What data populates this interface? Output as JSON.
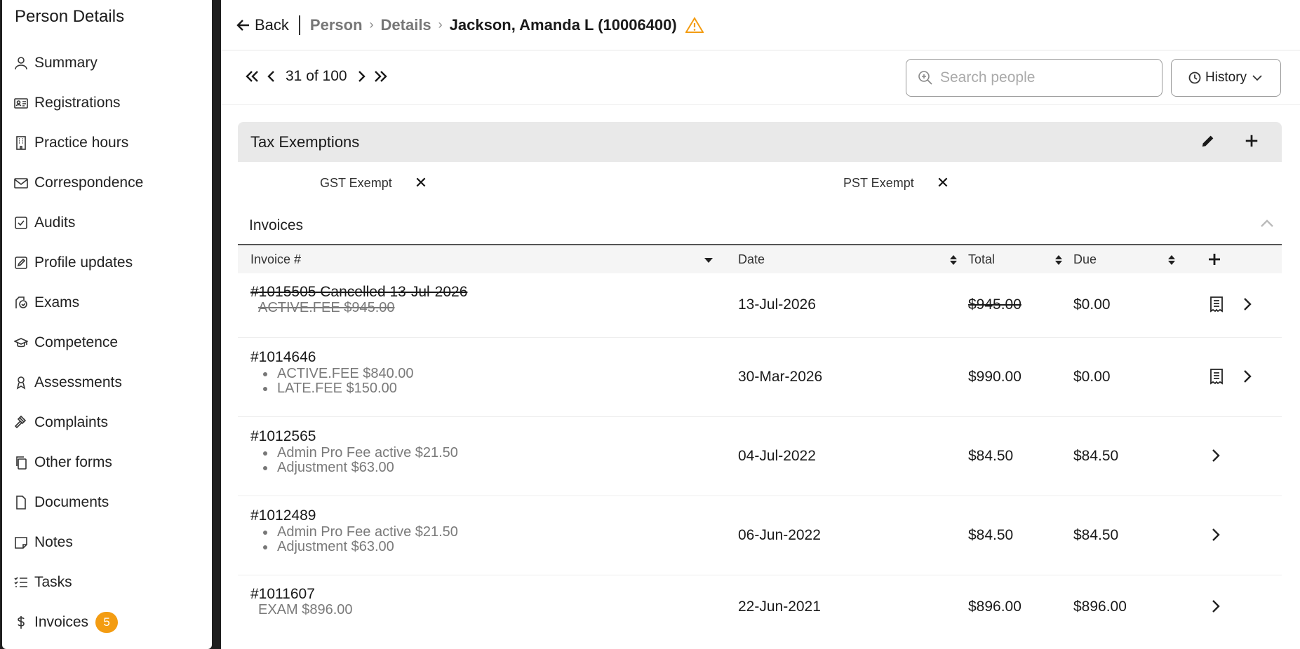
{
  "sidebar": {
    "title": "Person Details",
    "items": [
      {
        "label": "Summary",
        "icon": "person-icon"
      },
      {
        "label": "Registrations",
        "icon": "id-card-icon"
      },
      {
        "label": "Practice hours",
        "icon": "building-icon"
      },
      {
        "label": "Correspondence",
        "icon": "mail-icon"
      },
      {
        "label": "Audits",
        "icon": "checkbox-icon"
      },
      {
        "label": "Profile updates",
        "icon": "edit-square-icon"
      },
      {
        "label": "Exams",
        "icon": "exam-icon"
      },
      {
        "label": "Competence",
        "icon": "graduation-cap-icon"
      },
      {
        "label": "Assessments",
        "icon": "award-icon"
      },
      {
        "label": "Complaints",
        "icon": "gavel-icon"
      },
      {
        "label": "Other forms",
        "icon": "copy-icon"
      },
      {
        "label": "Documents",
        "icon": "document-icon"
      },
      {
        "label": "Notes",
        "icon": "note-icon"
      },
      {
        "label": "Tasks",
        "icon": "list-check-icon"
      },
      {
        "label": "Invoices",
        "icon": "dollar-icon",
        "badge": "5"
      }
    ]
  },
  "header": {
    "back_label": "Back",
    "crumbs": [
      "Person",
      "Details"
    ],
    "current": "Jackson, Amanda L (10006400)"
  },
  "pager": {
    "label": "31 of 100"
  },
  "search": {
    "placeholder": "Search people"
  },
  "history": {
    "label": "History"
  },
  "tax": {
    "title": "Tax Exemptions",
    "exemptions": [
      "GST Exempt",
      "PST Exempt"
    ]
  },
  "invoices": {
    "title": "Invoices",
    "columns": [
      "Invoice #",
      "Date",
      "Total",
      "Due"
    ],
    "rows": [
      {
        "number": "#1015505 Cancelled 13-Jul-2026",
        "lines": [
          "ACTIVE.FEE $945.00"
        ],
        "date": "13-Jul-2026",
        "total": "$945.00",
        "due": "$0.00",
        "cancelled": true
      },
      {
        "number": "#1014646",
        "lines": [
          "ACTIVE.FEE $840.00",
          "LATE.FEE $150.00"
        ],
        "date": "30-Mar-2026",
        "total": "$990.00",
        "due": "$0.00"
      },
      {
        "number": "#1012565",
        "lines": [
          "Admin Pro Fee active $21.50",
          "Adjustment $63.00"
        ],
        "date": "04-Jul-2022",
        "total": "$84.50",
        "due": "$84.50"
      },
      {
        "number": "#1012489",
        "lines": [
          "Admin Pro Fee active $21.50",
          "Adjustment $63.00"
        ],
        "date": "06-Jun-2022",
        "total": "$84.50",
        "due": "$84.50"
      },
      {
        "number": "#1011607",
        "lines": [
          "EXAM $896.00"
        ],
        "date": "22-Jun-2021",
        "total": "$896.00",
        "due": "$896.00"
      }
    ]
  },
  "colors": {
    "badge": "#f39c12",
    "warning": "#f39c12",
    "header_bg": "#e9e9e9"
  }
}
